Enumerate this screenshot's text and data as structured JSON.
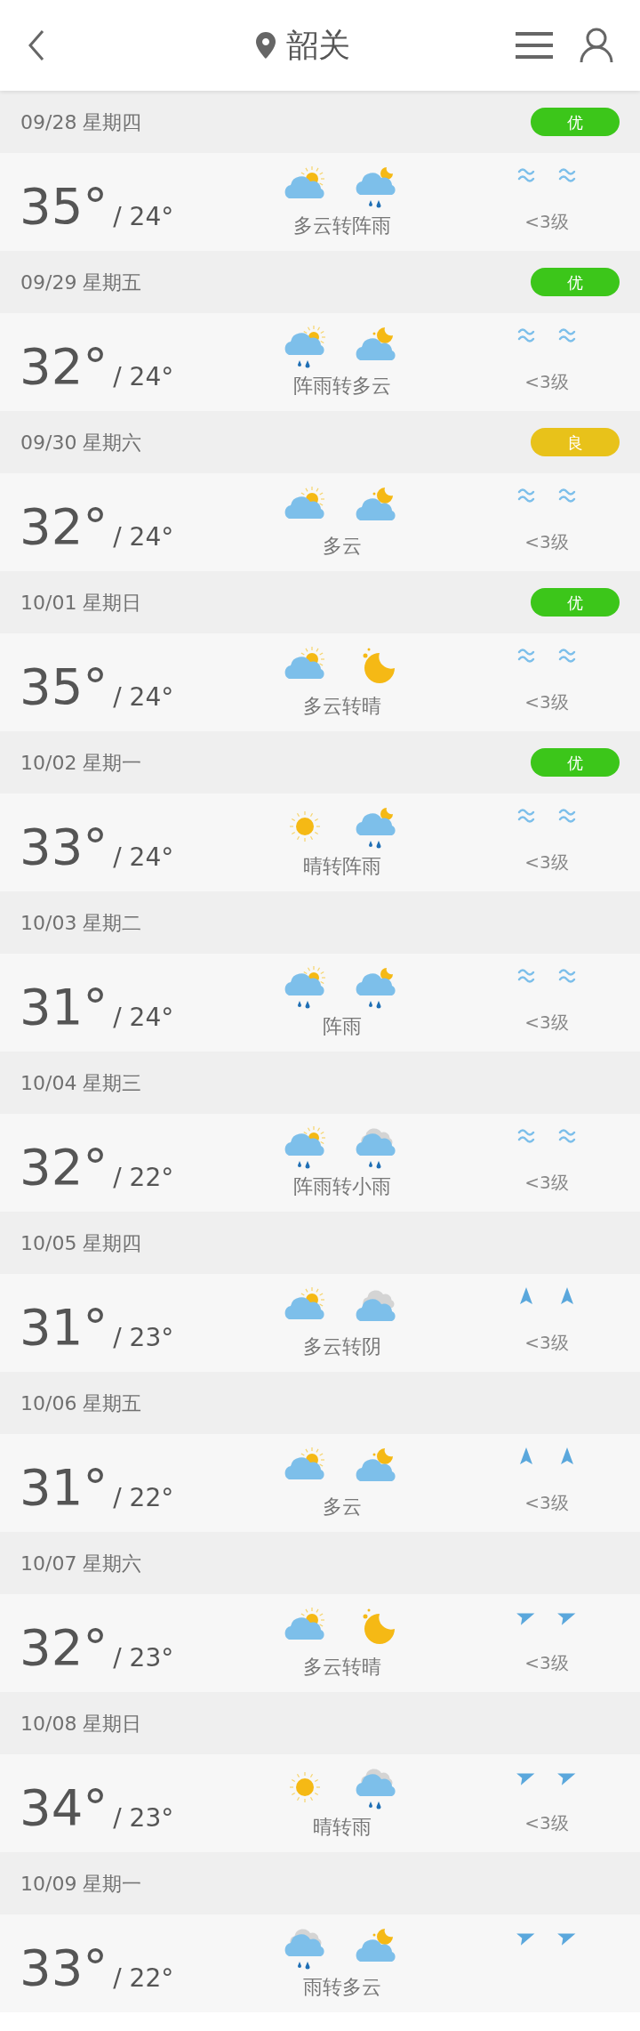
{
  "header": {
    "city": "韶关"
  },
  "days": [
    {
      "date": "09/28 星期四",
      "aqi": {
        "label": "优",
        "color": "#3cc61a"
      },
      "high": "35°",
      "low": "/ 24°",
      "icons": [
        {
          "kind": "partly_cloudy_day"
        },
        {
          "kind": "shower_night"
        }
      ],
      "condition": "多云转阵雨",
      "wind_marks": {
        "kind": "breeze"
      },
      "wind": "<3级"
    },
    {
      "date": "09/29 星期五",
      "aqi": {
        "label": "优",
        "color": "#3cc61a"
      },
      "high": "32°",
      "low": "/ 24°",
      "icons": [
        {
          "kind": "shower_day"
        },
        {
          "kind": "partly_cloudy_night"
        }
      ],
      "condition": "阵雨转多云",
      "wind_marks": {
        "kind": "breeze"
      },
      "wind": "<3级"
    },
    {
      "date": "09/30 星期六",
      "aqi": {
        "label": "良",
        "color": "#e8c21a"
      },
      "high": "32°",
      "low": "/ 24°",
      "icons": [
        {
          "kind": "partly_cloudy_day"
        },
        {
          "kind": "partly_cloudy_night"
        }
      ],
      "condition": "多云",
      "wind_marks": {
        "kind": "breeze"
      },
      "wind": "<3级"
    },
    {
      "date": "10/01 星期日",
      "aqi": {
        "label": "优",
        "color": "#3cc61a"
      },
      "high": "35°",
      "low": "/ 24°",
      "icons": [
        {
          "kind": "partly_cloudy_day"
        },
        {
          "kind": "clear_night"
        }
      ],
      "condition": "多云转晴",
      "wind_marks": {
        "kind": "breeze"
      },
      "wind": "<3级"
    },
    {
      "date": "10/02 星期一",
      "aqi": {
        "label": "优",
        "color": "#3cc61a"
      },
      "high": "33°",
      "low": "/ 24°",
      "icons": [
        {
          "kind": "sunny"
        },
        {
          "kind": "shower_night"
        }
      ],
      "condition": "晴转阵雨",
      "wind_marks": {
        "kind": "breeze"
      },
      "wind": "<3级"
    },
    {
      "date": "10/03 星期二",
      "high": "31°",
      "low": "/ 24°",
      "icons": [
        {
          "kind": "shower_day"
        },
        {
          "kind": "shower_night"
        }
      ],
      "condition": "阵雨",
      "wind_marks": {
        "kind": "breeze"
      },
      "wind": "<3级"
    },
    {
      "date": "10/04 星期三",
      "high": "32°",
      "low": "/ 22°",
      "icons": [
        {
          "kind": "shower_day"
        },
        {
          "kind": "rain"
        }
      ],
      "condition": "阵雨转小雨",
      "wind_marks": {
        "kind": "breeze"
      },
      "wind": "<3级"
    },
    {
      "date": "10/05 星期四",
      "high": "31°",
      "low": "/ 23°",
      "icons": [
        {
          "kind": "partly_cloudy_day"
        },
        {
          "kind": "overcast"
        }
      ],
      "condition": "多云转阴",
      "wind_marks": {
        "kind": "north"
      },
      "wind": "<3级"
    },
    {
      "date": "10/06 星期五",
      "high": "31°",
      "low": "/ 22°",
      "icons": [
        {
          "kind": "partly_cloudy_day"
        },
        {
          "kind": "partly_cloudy_night"
        }
      ],
      "condition": "多云",
      "wind_marks": {
        "kind": "north"
      },
      "wind": "<3级"
    },
    {
      "date": "10/07 星期六",
      "high": "32°",
      "low": "/ 23°",
      "icons": [
        {
          "kind": "partly_cloudy_day"
        },
        {
          "kind": "clear_night"
        }
      ],
      "condition": "多云转晴",
      "wind_marks": {
        "kind": "northeast"
      },
      "wind": "<3级"
    },
    {
      "date": "10/08 星期日",
      "high": "34°",
      "low": "/ 23°",
      "icons": [
        {
          "kind": "sunny"
        },
        {
          "kind": "rain"
        }
      ],
      "condition": "晴转雨",
      "wind_marks": {
        "kind": "northeast"
      },
      "wind": "<3级"
    },
    {
      "date": "10/09 星期一",
      "high": "33°",
      "low": "/ 22°",
      "icons": [
        {
          "kind": "rain"
        },
        {
          "kind": "partly_cloudy_night"
        }
      ],
      "condition": "雨转多云",
      "wind_marks": {
        "kind": "northeast"
      }
    }
  ]
}
